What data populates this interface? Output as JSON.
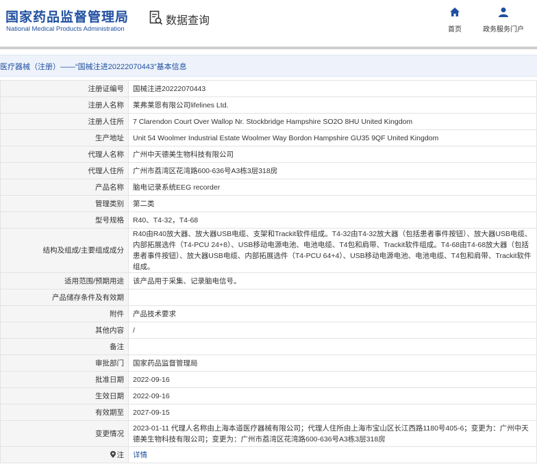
{
  "header": {
    "logo_cn": "国家药品监督管理局",
    "logo_en": "National Medical Products Administration",
    "query_label": "数据查询",
    "nav_home": "首页",
    "nav_service": "政务服务门户"
  },
  "breadcrumb": "医疗器械（注册）——“国械注进20222070443”基本信息",
  "rows": [
    {
      "label": "注册证编号",
      "value": "国械注进20222070443"
    },
    {
      "label": "注册人名称",
      "value": "莱弗莱恩有限公司lifelines Ltd."
    },
    {
      "label": "注册人住所",
      "value": "7 Clarendon Court Over Wallop Nr. Stockbridge Hampshire SO2O 8HU United Kingdom"
    },
    {
      "label": "生产地址",
      "value": "Unit 54 Woolmer Industrial Estate Woolmer Way Bordon Hampshire GU35 9QF United Kingdom"
    },
    {
      "label": "代理人名称",
      "value": "广州中天德美生物科技有限公司"
    },
    {
      "label": "代理人住所",
      "value": "广州市荔湾区花湾路600-636号A3栋3层318房"
    },
    {
      "label": "产品名称",
      "value": "脑电记录系统EEG recorder"
    },
    {
      "label": "管理类别",
      "value": "第二类"
    },
    {
      "label": "型号规格",
      "value": "R40、T4-32，T4-68"
    },
    {
      "label": "结构及组成/主要组成成分",
      "value": "R40由R40放大器、放大器USB电缆、支架和Trackit软件组成。T4-32由T4-32放大器（包括患者事件按钮）、放大器USB电缆、内部拓展选件（T4-PCU 24+8）、USB移动电源电池、电池电缆、T4包和肩带、Trackit软件组成。T4-68由T4-68放大器（包括患者事件按钮）、放大器USB电缆、内部拓展选件（T4-PCU 64+4）、USB移动电源电池、电池电缆、T4包和肩带、Trackit软件组成。"
    },
    {
      "label": "适用范围/预期用途",
      "value": "该产品用于采集、记录脑电信号。"
    },
    {
      "label": "产品储存条件及有效期",
      "value": ""
    },
    {
      "label": "附件",
      "value": "产品技术要求"
    },
    {
      "label": "其他内容",
      "value": "/"
    },
    {
      "label": "备注",
      "value": ""
    },
    {
      "label": "审批部门",
      "value": "国家药品监督管理局"
    },
    {
      "label": "批准日期",
      "value": "2022-09-16"
    },
    {
      "label": "生效日期",
      "value": "2022-09-16"
    },
    {
      "label": "有效期至",
      "value": "2027-09-15"
    },
    {
      "label": "变更情况",
      "value": "2023-01-11 代理人名称由上海本道医疗器械有限公司；代理人住所由上海市宝山区长江西路1180号405-6；变更为：广州中天德美生物科技有限公司；变更为：广州市荔湾区花湾路600-636号A3栋3层318房"
    }
  ],
  "note_row": {
    "label": "注",
    "value": "详情"
  }
}
